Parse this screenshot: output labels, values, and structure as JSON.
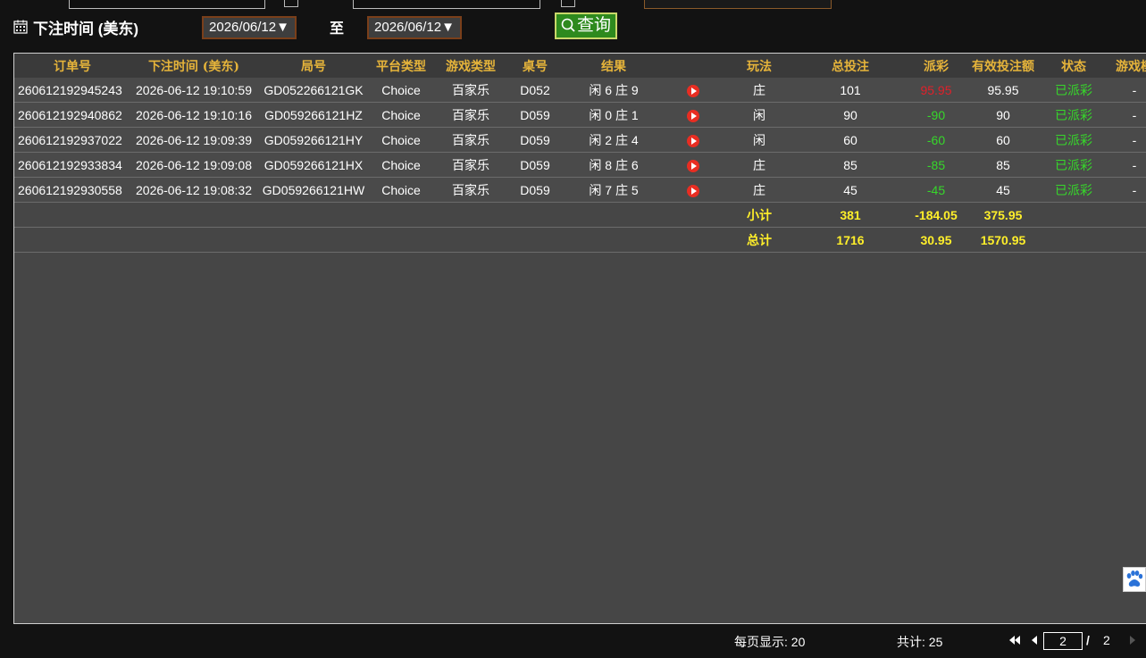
{
  "filter": {
    "date_label": "下注时间 (美东)",
    "start_date": "2026/06/12▼",
    "to_label": "至",
    "end_date": "2026/06/12▼",
    "query_label": "查询"
  },
  "table": {
    "headers": [
      "订单号",
      "下注时间 (美东)",
      "局号",
      "平台类型",
      "游戏类型",
      "桌号",
      "结果",
      "",
      "玩法",
      "总投注",
      "派彩",
      "有效投注额",
      "状态",
      "游戏模"
    ],
    "rows": [
      {
        "order": "260612192945243",
        "time": "2026-06-12 19:10:59",
        "round": "GD052266121GK",
        "platform": "Choice",
        "game": "百家乐",
        "table_no": "D052",
        "result": "闲 6 庄 9",
        "play": "庄",
        "bet": "101",
        "payout": "95.95",
        "payout_color": "red",
        "valid": "95.95",
        "status": "已派彩",
        "mode": "-"
      },
      {
        "order": "260612192940862",
        "time": "2026-06-12 19:10:16",
        "round": "GD059266121HZ",
        "platform": "Choice",
        "game": "百家乐",
        "table_no": "D059",
        "result": "闲 0 庄 1",
        "play": "闲",
        "bet": "90",
        "payout": "-90",
        "payout_color": "green",
        "valid": "90",
        "status": "已派彩",
        "mode": "-"
      },
      {
        "order": "260612192937022",
        "time": "2026-06-12 19:09:39",
        "round": "GD059266121HY",
        "platform": "Choice",
        "game": "百家乐",
        "table_no": "D059",
        "result": "闲 2 庄 4",
        "play": "闲",
        "bet": "60",
        "payout": "-60",
        "payout_color": "green",
        "valid": "60",
        "status": "已派彩",
        "mode": "-"
      },
      {
        "order": "260612192933834",
        "time": "2026-06-12 19:09:08",
        "round": "GD059266121HX",
        "platform": "Choice",
        "game": "百家乐",
        "table_no": "D059",
        "result": "闲 8 庄 6",
        "play": "庄",
        "bet": "85",
        "payout": "-85",
        "payout_color": "green",
        "valid": "85",
        "status": "已派彩",
        "mode": "-"
      },
      {
        "order": "260612192930558",
        "time": "2026-06-12 19:08:32",
        "round": "GD059266121HW",
        "platform": "Choice",
        "game": "百家乐",
        "table_no": "D059",
        "result": "闲 7 庄 5",
        "play": "庄",
        "bet": "45",
        "payout": "-45",
        "payout_color": "green",
        "valid": "45",
        "status": "已派彩",
        "mode": "-"
      }
    ],
    "subtotal": {
      "label": "小计",
      "bet": "381",
      "payout": "-184.05",
      "valid": "375.95"
    },
    "total": {
      "label": "总计",
      "bet": "1716",
      "payout": "30.95",
      "valid": "1570.95"
    }
  },
  "footer": {
    "per_page": "每页显示: 20",
    "total_count": "共计: 25",
    "current_page": "2",
    "separator": "/",
    "total_pages": "2"
  },
  "colors": {
    "header_text": "#e6b43a",
    "loss": "#36d82a",
    "win": "#e0202a",
    "summary": "#ffef2a",
    "query_button": "#2e8a1e"
  }
}
